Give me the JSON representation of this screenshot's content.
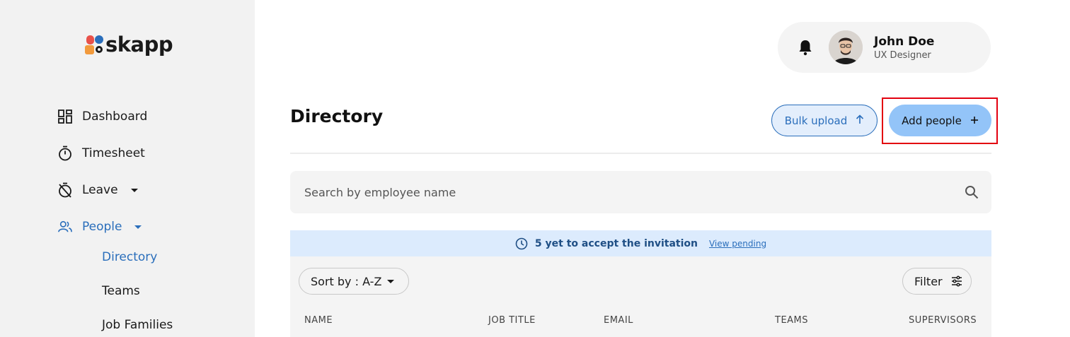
{
  "brand": {
    "name": "skapp"
  },
  "sidebar": {
    "items": [
      {
        "label": "Dashboard",
        "icon": "dashboard-icon"
      },
      {
        "label": "Timesheet",
        "icon": "stopwatch-icon"
      },
      {
        "label": "Leave",
        "icon": "leave-timer-icon"
      },
      {
        "label": "People",
        "icon": "people-icon"
      }
    ],
    "people_sub": [
      {
        "label": "Directory"
      },
      {
        "label": "Teams"
      },
      {
        "label": "Job Families"
      }
    ]
  },
  "profile": {
    "name": "John Doe",
    "role": "UX Designer"
  },
  "page": {
    "title": "Directory"
  },
  "actions": {
    "bulk_upload": "Bulk upload",
    "add_people": "Add people"
  },
  "search": {
    "placeholder": "Search by employee name"
  },
  "invite_banner": {
    "text": "5 yet to accept the invitation",
    "link": "View pending"
  },
  "table": {
    "sort_label": "Sort by : A-Z",
    "filter_label": "Filter",
    "columns": [
      "NAME",
      "JOB TITLE",
      "EMAIL",
      "TEAMS",
      "SUPERVISORS"
    ]
  },
  "colors": {
    "accent": "#2a6ebb",
    "primary_button": "#93c4f8",
    "banner": "#dcebfd",
    "highlight": "#e3000f"
  }
}
